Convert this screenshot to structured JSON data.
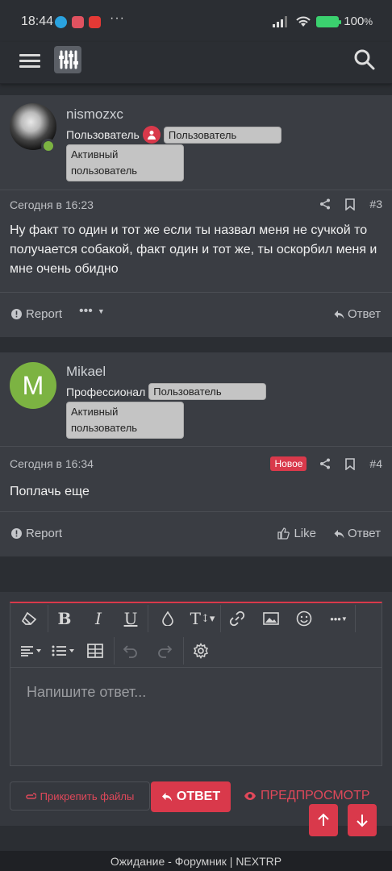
{
  "status_bar": {
    "time": "18:44",
    "battery": "100"
  },
  "header": {
    "menu_icon": "hamburger-icon",
    "logo_icon": "equalizer-logo",
    "search_icon": "search-icon"
  },
  "posts": [
    {
      "username": "nismozxc",
      "role": "Пользователь",
      "badge": "Пользователь",
      "extra_badge": "Активный пользователь",
      "date": "Сегодня в 16:23",
      "number": "#3",
      "body": "Ну факт то один и тот же если ты назвал меня не сучкой то получается собакой, факт один и тот же, ты оскорбил меня и мне очень обидно",
      "report": "Report",
      "reply": "Ответ"
    },
    {
      "username": "Mikael",
      "avatar_letter": "M",
      "role": "Профессионал",
      "badge": "Пользователь",
      "extra_badge": "Активный пользователь",
      "date": "Сегодня в 16:34",
      "new_label": "Новое",
      "number": "#4",
      "body": "Поплачь еще",
      "report": "Report",
      "like": "Like",
      "reply": "Ответ"
    }
  ],
  "editor": {
    "placeholder": "Напишите ответ...",
    "attach_label": "Прикрепить файлы",
    "reply_label": "ОТВЕТ",
    "preview_label": "ПРЕДПРОСМОТР"
  },
  "footer": {
    "title": "Ожидание - Форумник | NEXTRP"
  },
  "colors": {
    "accent": "#d9394b",
    "avatar_green": "#7cb342",
    "background": "#2b2e33",
    "card": "#3a3d43"
  }
}
